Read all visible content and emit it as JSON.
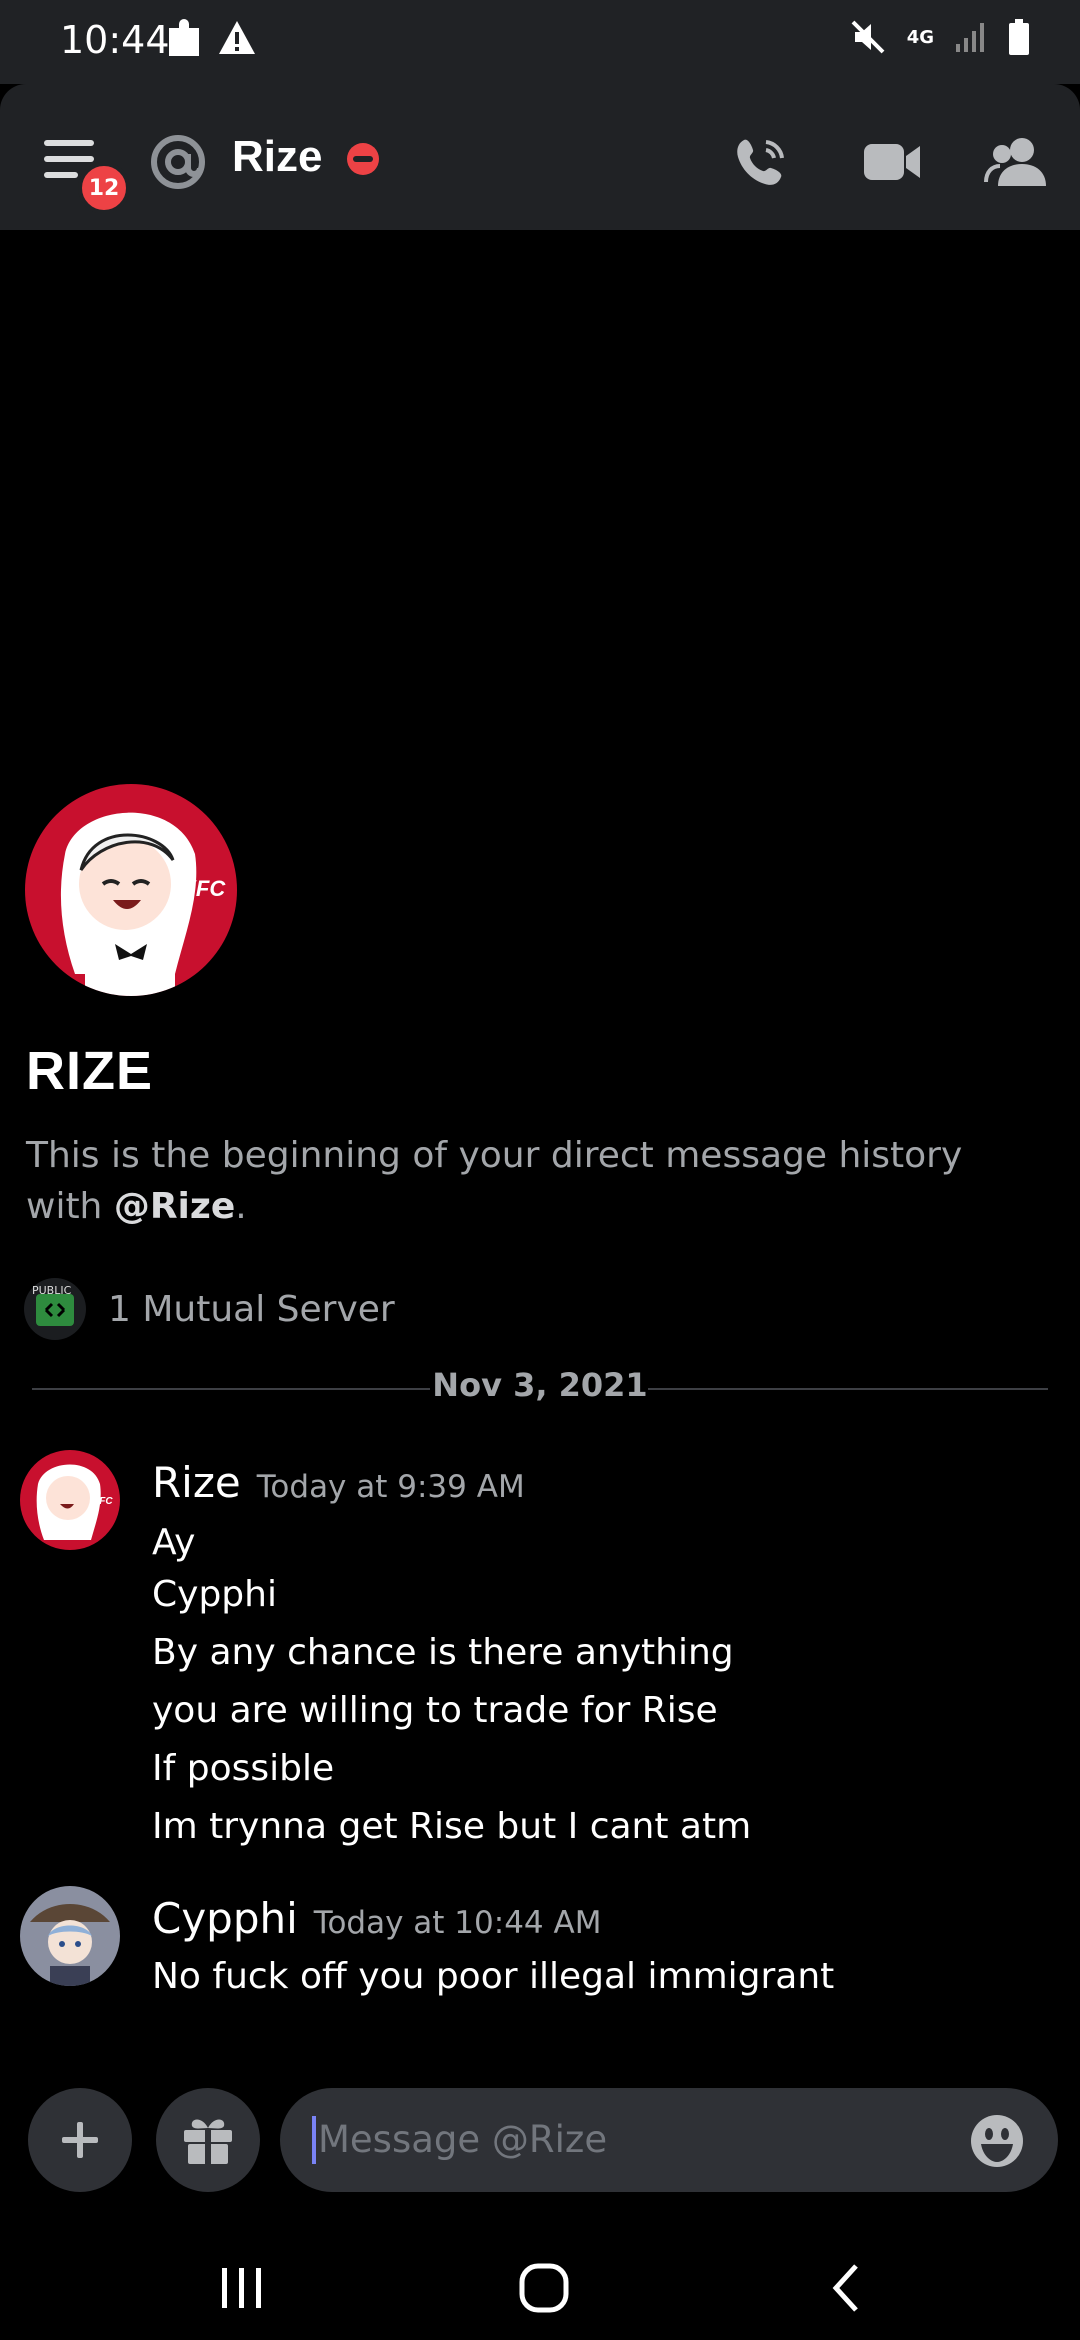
{
  "status_bar": {
    "time": "10:44",
    "network": "4G"
  },
  "header": {
    "badge": "12",
    "title": "Rize"
  },
  "profile": {
    "name": "RIZE",
    "intro_text": "This is the beginning of your direct message history with ",
    "intro_mention": "@Rize",
    "intro_end": ".",
    "mutual_icon_label": "PUBLIC",
    "mutual_servers": "1 Mutual Server"
  },
  "divider": {
    "date": "Nov 3, 2021"
  },
  "messages": [
    {
      "author": "Rize",
      "timestamp": "Today at 9:39 AM",
      "lines": [
        "Ay",
        "Cypphi",
        "By any chance is there anything",
        "you are willing to trade for Rise",
        "If possible",
        "Im trynna get Rise but I cant atm"
      ]
    },
    {
      "author": "Cypphi",
      "timestamp": "Today at 10:44 AM",
      "lines": [
        "No fuck off you poor illegal immigrant"
      ]
    }
  ],
  "composer": {
    "placeholder": "Message @Rize"
  },
  "colors": {
    "background": "#000000",
    "header": "#202225",
    "input": "#2f3136",
    "danger": "#ed4245",
    "muted_text": "#a3a6aa"
  }
}
